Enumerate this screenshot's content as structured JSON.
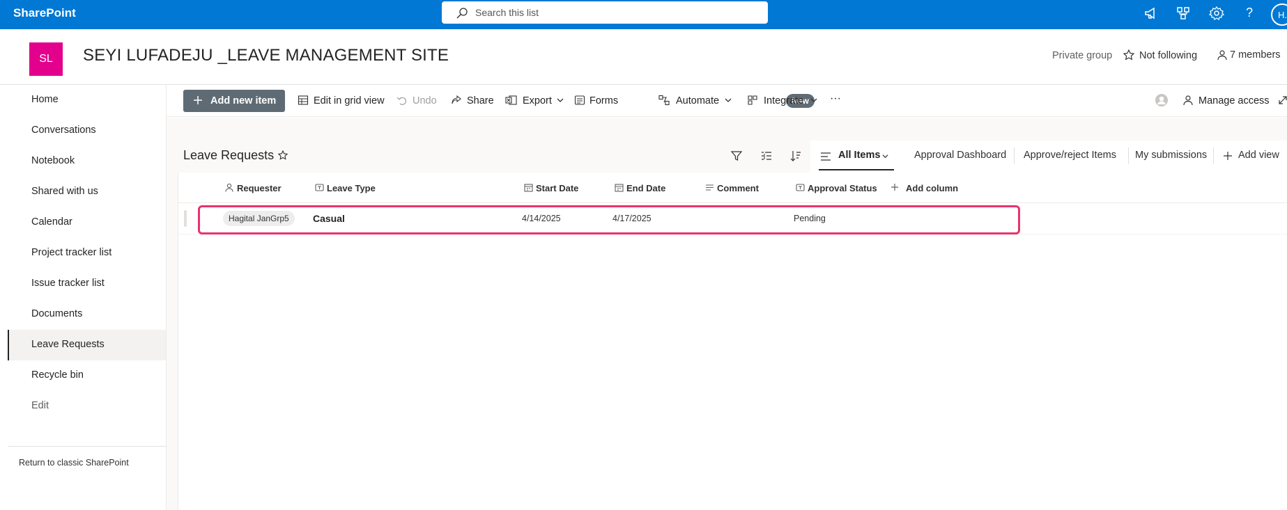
{
  "suitebar": {
    "app_name": "SharePoint",
    "search_placeholder": "Search this list",
    "user_initials": "H."
  },
  "site": {
    "logo_initials": "SL",
    "title": "SEYI LUFADEJU _LEAVE MANAGEMENT SITE",
    "privacy": "Private group",
    "follow_label": "Not following",
    "members_label": "7 members"
  },
  "nav": {
    "items": [
      {
        "label": "Home"
      },
      {
        "label": "Conversations"
      },
      {
        "label": "Notebook"
      },
      {
        "label": "Shared with us"
      },
      {
        "label": "Calendar"
      },
      {
        "label": "Project tracker list"
      },
      {
        "label": "Issue tracker list"
      },
      {
        "label": "Documents"
      },
      {
        "label": "Leave Requests"
      },
      {
        "label": "Recycle bin"
      },
      {
        "label": "Edit"
      }
    ],
    "active_index": 8,
    "return_classic": "Return to classic SharePoint"
  },
  "commandbar": {
    "add_new_item": "Add new item",
    "edit_grid": "Edit in grid view",
    "undo": "Undo",
    "share": "Share",
    "export": "Export",
    "forms": "Forms",
    "forms_badge": "New",
    "automate": "Automate",
    "integrate": "Integrate",
    "more": "···",
    "manage_access": "Manage access"
  },
  "list": {
    "title": "Leave Requests",
    "views": {
      "all_items": "All Items",
      "approval_dashboard": "Approval Dashboard",
      "approve_reject": "Approve/reject Items",
      "my_submissions": "My submissions",
      "add_view": "Add view"
    },
    "columns": {
      "requester": "Requester",
      "leave_type": "Leave Type",
      "start_date": "Start Date",
      "end_date": "End Date",
      "comment": "Comment",
      "approval_status": "Approval Status",
      "add_column": "Add column"
    },
    "rows": [
      {
        "requester": "Hagital JanGrp5",
        "leave_type": "Casual",
        "start_date": "4/14/2025",
        "end_date": "4/17/2025",
        "comment": "",
        "approval_status": "Pending"
      }
    ]
  },
  "colors": {
    "suitebar": "#0078d4",
    "site_logo": "#e3008c",
    "highlight": "#e8336d"
  }
}
